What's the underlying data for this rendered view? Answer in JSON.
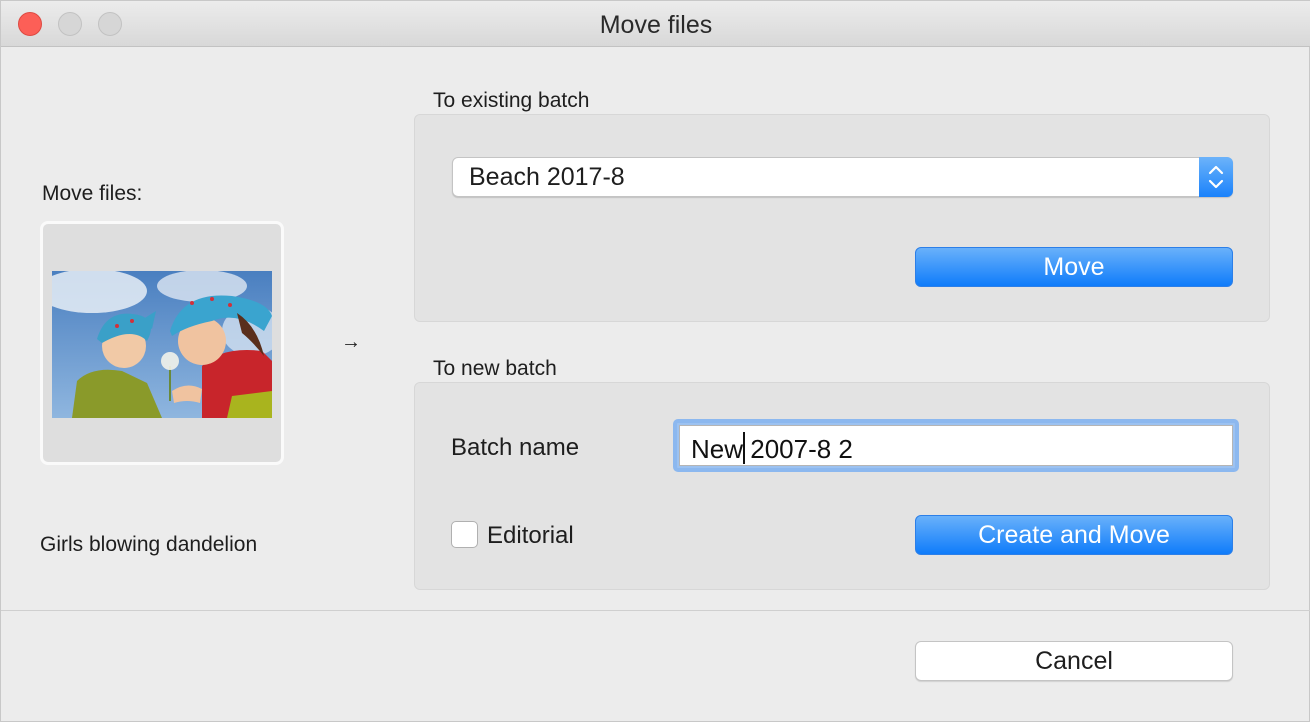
{
  "window": {
    "title": "Move files"
  },
  "left": {
    "heading": "Move files:",
    "thumbnail_caption": "Girls blowing dandelion",
    "arrow": "→"
  },
  "existing_batch": {
    "section_label": "To existing batch",
    "selected_batch": "Beach 2017-8",
    "move_label": "Move"
  },
  "new_batch": {
    "section_label": "To new batch",
    "name_label": "Batch name",
    "name_value": "New 2007-8 2",
    "editorial_label": "Editorial",
    "editorial_checked": false,
    "create_label": "Create and Move"
  },
  "footer": {
    "cancel_label": "Cancel"
  },
  "colors": {
    "accent": "#1a82fb",
    "close": "#fc5f57",
    "focus_ring": "#8cb8ef"
  }
}
